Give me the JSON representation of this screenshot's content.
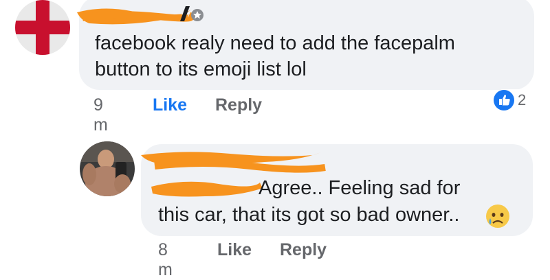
{
  "comments": [
    {
      "text": "facebook realy need to add the facepalm\nbutton to its emoji list lol",
      "time": "9 m",
      "like_label": "Like",
      "reply_label": "Reply",
      "liked": true,
      "reaction_count": "2",
      "reaction_type": "like-icon",
      "author_badge": "top-fan-icon",
      "avatar": "england-flag-avatar"
    },
    {
      "text_line1": "Agree.. Feeling sad for",
      "text_line2": "this car, that its got so bad owner..",
      "emoji": "crying-face-emoji",
      "time": "8 m",
      "like_label": "Like",
      "reply_label": "Reply",
      "liked": false,
      "avatar": "man-selfie-avatar"
    }
  ],
  "colors": {
    "bubble": "#f0f2f5",
    "like_active": "#1877f2",
    "meta": "#65676b",
    "redaction": "#f7931e"
  }
}
